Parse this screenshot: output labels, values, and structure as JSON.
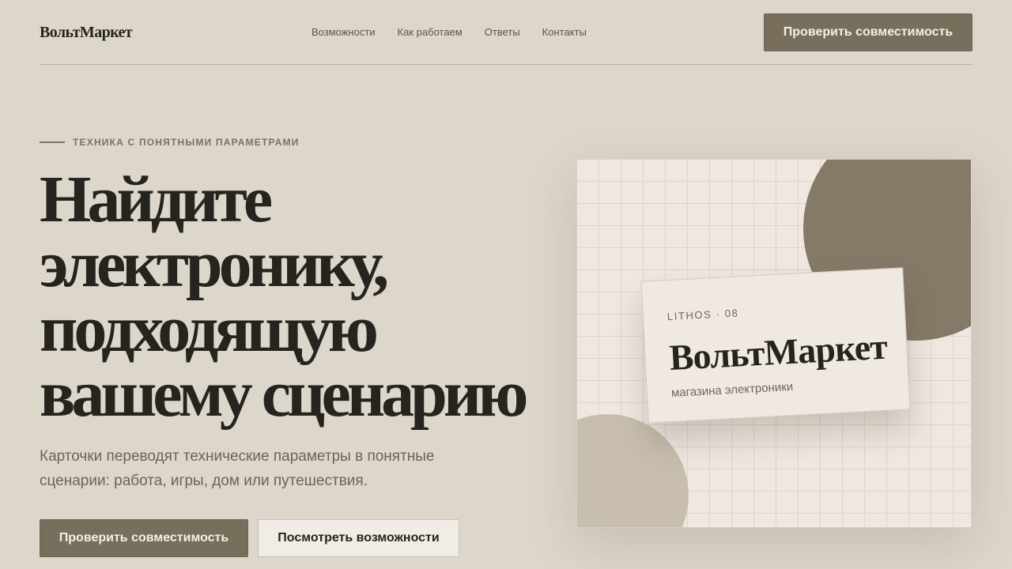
{
  "header": {
    "logo": "ВольтМаркет",
    "nav": [
      "Возможности",
      "Как работаем",
      "Ответы",
      "Контакты"
    ],
    "cta_label": "Проверить совместимость"
  },
  "hero": {
    "eyebrow": "ТЕХНИКА С ПОНЯТНЫМИ ПАРАМЕТРАМИ",
    "title_lines": [
      "Найдите",
      "электронику,",
      "подходящую",
      "вашему сценарию"
    ],
    "subtitle": "Карточки переводят технические параметры в понятные сценарии: работа, игры, дом или путешествия.",
    "primary_cta": "Проверить совместимость",
    "secondary_cta": "Посмотреть возможности"
  },
  "visual": {
    "tag": "LITHOS · 08",
    "brand": "ВольтМаркет",
    "caption": "магазина электроники"
  },
  "colors": {
    "background": "#ddd6cb",
    "accent": "#786e5c",
    "text": "#26241f",
    "muted": "#6a645a",
    "circle_dark": "#857a67",
    "circle_light": "#c7beae"
  }
}
